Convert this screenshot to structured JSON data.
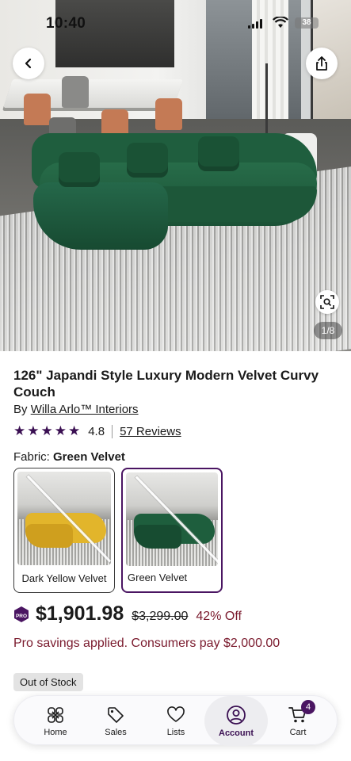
{
  "status_bar": {
    "time": "10:40",
    "battery": "38"
  },
  "hero": {
    "image_counter": "1/8"
  },
  "product": {
    "title": "126\" Japandi Style Luxury Modern Velvet Curvy Couch",
    "by_prefix": "By ",
    "brand": "Willa Arlo™ Interiors",
    "stars": "★★★★★",
    "rating": "4.8",
    "reviews": "57 Reviews",
    "fabric_label": "Fabric: ",
    "fabric_value": "Green Velvet",
    "swatches": [
      {
        "label": "Dark Yellow Velvet",
        "color": "#e2b52b",
        "selected": false
      },
      {
        "label": "Green Velvet",
        "color": "#1e5e3d",
        "selected": true
      }
    ],
    "price": "$1,901.98",
    "original_price": "$3,299.00",
    "discount": "42% Off",
    "pro_savings": "Pro savings applied. Consumers pay $2,000.00",
    "stock_status": "Out of Stock",
    "pro_badge": "PRO"
  },
  "nav": {
    "items": [
      {
        "label": "Home",
        "icon": "home-icon"
      },
      {
        "label": "Sales",
        "icon": "tag-icon"
      },
      {
        "label": "Lists",
        "icon": "heart-icon"
      },
      {
        "label": "Account",
        "icon": "account-icon",
        "active": true
      },
      {
        "label": "Cart",
        "icon": "cart-icon"
      }
    ],
    "cart_count": "4"
  },
  "colors": {
    "brand_purple": "#4a1562",
    "pro_red": "#7a1a2d"
  }
}
